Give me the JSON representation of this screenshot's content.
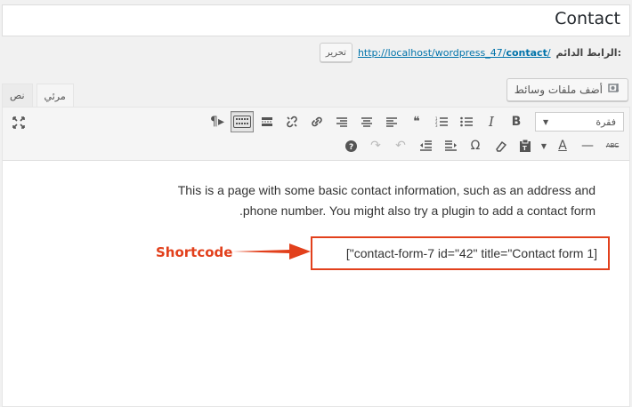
{
  "title": {
    "value": "Contact"
  },
  "permalink": {
    "label": "الرابط الدائم:",
    "url_prefix": "http://localhost/wordpress_47/",
    "url_slug": "contact",
    "url_suffix": "/",
    "edit_label": "تحرير"
  },
  "media": {
    "add_label": "أضف ملفات وسائط",
    "icon": "camera-music-icon"
  },
  "tabs": {
    "visual": "مرئي",
    "text": "نص"
  },
  "toolbar": {
    "format_select": "فقرة",
    "row1_icons": [
      "rtl-paragraph-icon",
      "toolbar-toggle-icon",
      "more-tag-icon",
      "unlink-icon",
      "link-icon",
      "align-right-icon",
      "align-center-icon",
      "align-left-icon",
      "blockquote-icon",
      "ordered-list-icon",
      "bullet-list-icon",
      "italic-icon",
      "bold-icon"
    ],
    "row2_icons": [
      "help-icon",
      "redo-icon",
      "undo-icon",
      "outdent-icon",
      "indent-icon",
      "special-char-icon",
      "clear-format-icon",
      "paste-text-icon",
      "text-color-icon",
      "horizontal-rule-icon",
      "strikethrough-icon"
    ],
    "bold": "B",
    "italic": "I",
    "strike": "ABC",
    "omega": "Ω",
    "text_color": "A"
  },
  "content": {
    "line1": "This is a page with some basic contact information, such as an address and",
    "line2": ".phone number. You might also try a plugin to add a contact form",
    "shortcode": "[\"contact-form-7 id=\"42\" title=\"Contact form 1]"
  },
  "annotation": {
    "label": "Shortcode",
    "color": "#e2401c"
  }
}
